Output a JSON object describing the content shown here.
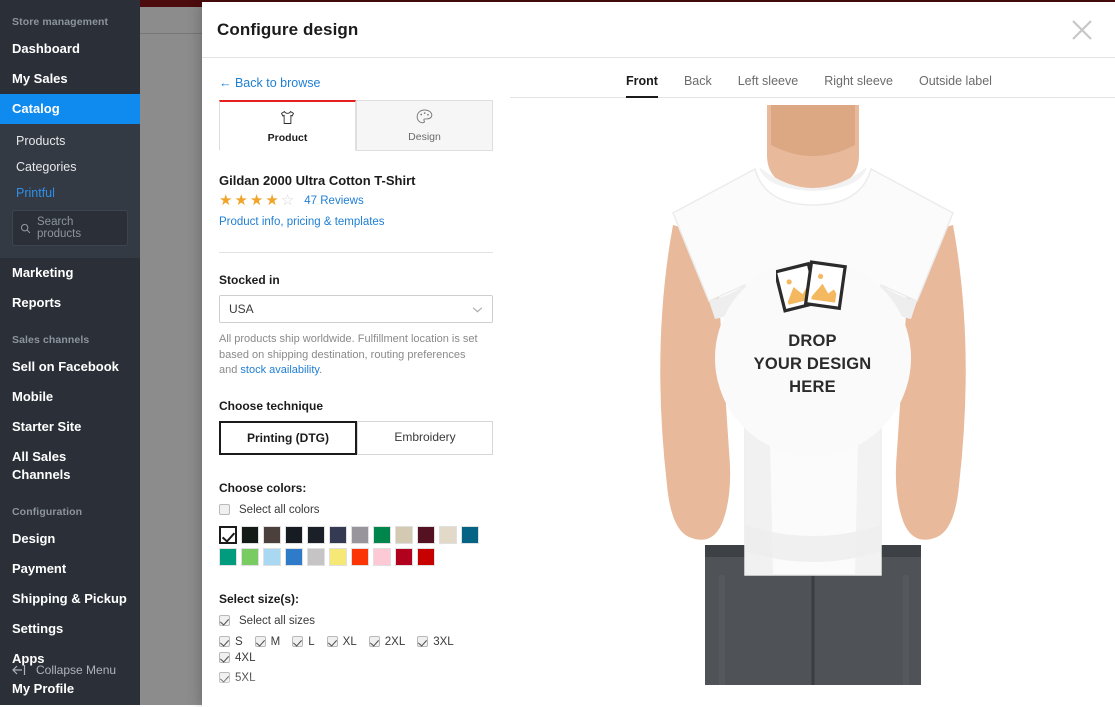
{
  "sidebar": {
    "groups": [
      {
        "heading": "Store management",
        "items": [
          {
            "label": "Dashboard",
            "active": false
          },
          {
            "label": "My Sales",
            "active": false
          },
          {
            "label": "Catalog",
            "active": true
          }
        ]
      }
    ],
    "catalog_sub": [
      {
        "label": "Products",
        "is_link": false
      },
      {
        "label": "Categories",
        "is_link": false
      },
      {
        "label": "Printful",
        "is_link": true
      }
    ],
    "search_placeholder": "Search products",
    "mid_items": [
      {
        "label": "Marketing"
      },
      {
        "label": "Reports"
      }
    ],
    "sales_channels_heading": "Sales channels",
    "sales_channels": [
      {
        "label": "Sell on Facebook"
      },
      {
        "label": "Mobile"
      },
      {
        "label": "Starter Site"
      },
      {
        "label": "All Sales Channels"
      }
    ],
    "configuration_heading": "Configuration",
    "configuration": [
      {
        "label": "Design"
      },
      {
        "label": "Payment"
      },
      {
        "label": "Shipping & Pickup"
      },
      {
        "label": "Settings"
      },
      {
        "label": "Apps"
      },
      {
        "label": "My Profile"
      }
    ],
    "collapse_label": "Collapse Menu",
    "active_color": "#0f8bf0",
    "bg_color": "#2b3038"
  },
  "modal": {
    "title": "Configure design",
    "close_icon": "close-icon",
    "back_link": "← Back to browse",
    "tabs": [
      {
        "label": "Product",
        "icon": "tshirt-icon",
        "active": true
      },
      {
        "label": "Design",
        "icon": "palette-icon",
        "active": false
      }
    ]
  },
  "product": {
    "name": "Gildan 2000 Ultra Cotton T-Shirt",
    "rating": 4,
    "rating_max": 5,
    "reviews_label": "47 Reviews",
    "info_link": "Product info, pricing & templates"
  },
  "stocked_in": {
    "label": "Stocked in",
    "value": "USA",
    "options": [
      "USA"
    ],
    "help_prefix": "All products ship worldwide. Fulfillment location is set based on shipping destination, routing preferences and ",
    "help_link": "stock availability",
    "help_suffix": "."
  },
  "technique": {
    "label": "Choose technique",
    "options": [
      {
        "label": "Printing (DTG)",
        "selected": true
      },
      {
        "label": "Embroidery",
        "selected": false
      }
    ]
  },
  "colors": {
    "label": "Choose colors:",
    "select_all_label": "Select all colors",
    "select_all_checked": false,
    "swatches": [
      {
        "name": "White",
        "hex": "#ffffff",
        "selected": true
      },
      {
        "name": "Black",
        "hex": "#141a16",
        "selected": false
      },
      {
        "name": "Dark Chocolate",
        "hex": "#4b403b",
        "selected": false
      },
      {
        "name": "Navy Black",
        "hex": "#171b22",
        "selected": false
      },
      {
        "name": "Dark Heather",
        "hex": "#1b1f28",
        "selected": false
      },
      {
        "name": "Navy",
        "hex": "#343a52",
        "selected": false
      },
      {
        "name": "Sport Grey",
        "hex": "#99959c",
        "selected": false
      },
      {
        "name": "Irish Green",
        "hex": "#00854c",
        "selected": false
      },
      {
        "name": "Sand",
        "hex": "#d4c9b2",
        "selected": false
      },
      {
        "name": "Maroon",
        "hex": "#531122",
        "selected": false
      },
      {
        "name": "Natural",
        "hex": "#e2d9c8",
        "selected": false
      },
      {
        "name": "Indigo Blue",
        "hex": "#056386",
        "selected": false
      },
      {
        "name": "Jade Dome",
        "hex": "#009c7d",
        "selected": false
      },
      {
        "name": "Lime",
        "hex": "#79cc62",
        "selected": false
      },
      {
        "name": "Light Blue",
        "hex": "#a9d8f2",
        "selected": false
      },
      {
        "name": "Royal",
        "hex": "#2e7bc9",
        "selected": false
      },
      {
        "name": "Ice Grey",
        "hex": "#c6c4c5",
        "selected": false
      },
      {
        "name": "Daisy",
        "hex": "#f6e876",
        "selected": false
      },
      {
        "name": "Orange",
        "hex": "#fb3506",
        "selected": false
      },
      {
        "name": "Light Pink",
        "hex": "#fdc9d5",
        "selected": false
      },
      {
        "name": "Cardinal Red",
        "hex": "#b2001f",
        "selected": false
      },
      {
        "name": "Red",
        "hex": "#c70000",
        "selected": false
      }
    ]
  },
  "sizes": {
    "label": "Select size(s):",
    "select_all_label": "Select all sizes",
    "select_all_checked": true,
    "items": [
      {
        "label": "S",
        "checked": true
      },
      {
        "label": "M",
        "checked": true
      },
      {
        "label": "L",
        "checked": true
      },
      {
        "label": "XL",
        "checked": true
      },
      {
        "label": "2XL",
        "checked": true
      },
      {
        "label": "3XL",
        "checked": true
      },
      {
        "label": "4XL",
        "checked": true
      },
      {
        "label": "5XL",
        "checked": true
      }
    ]
  },
  "preview": {
    "tabs": [
      {
        "label": "Front",
        "active": true
      },
      {
        "label": "Back",
        "active": false
      },
      {
        "label": "Left sleeve",
        "active": false
      },
      {
        "label": "Right sleeve",
        "active": false
      },
      {
        "label": "Outside label",
        "active": false
      }
    ],
    "dropzone": {
      "line1": "DROP",
      "line2": "YOUR DESIGN",
      "line3": "HERE",
      "icon": "photos-icon"
    }
  }
}
